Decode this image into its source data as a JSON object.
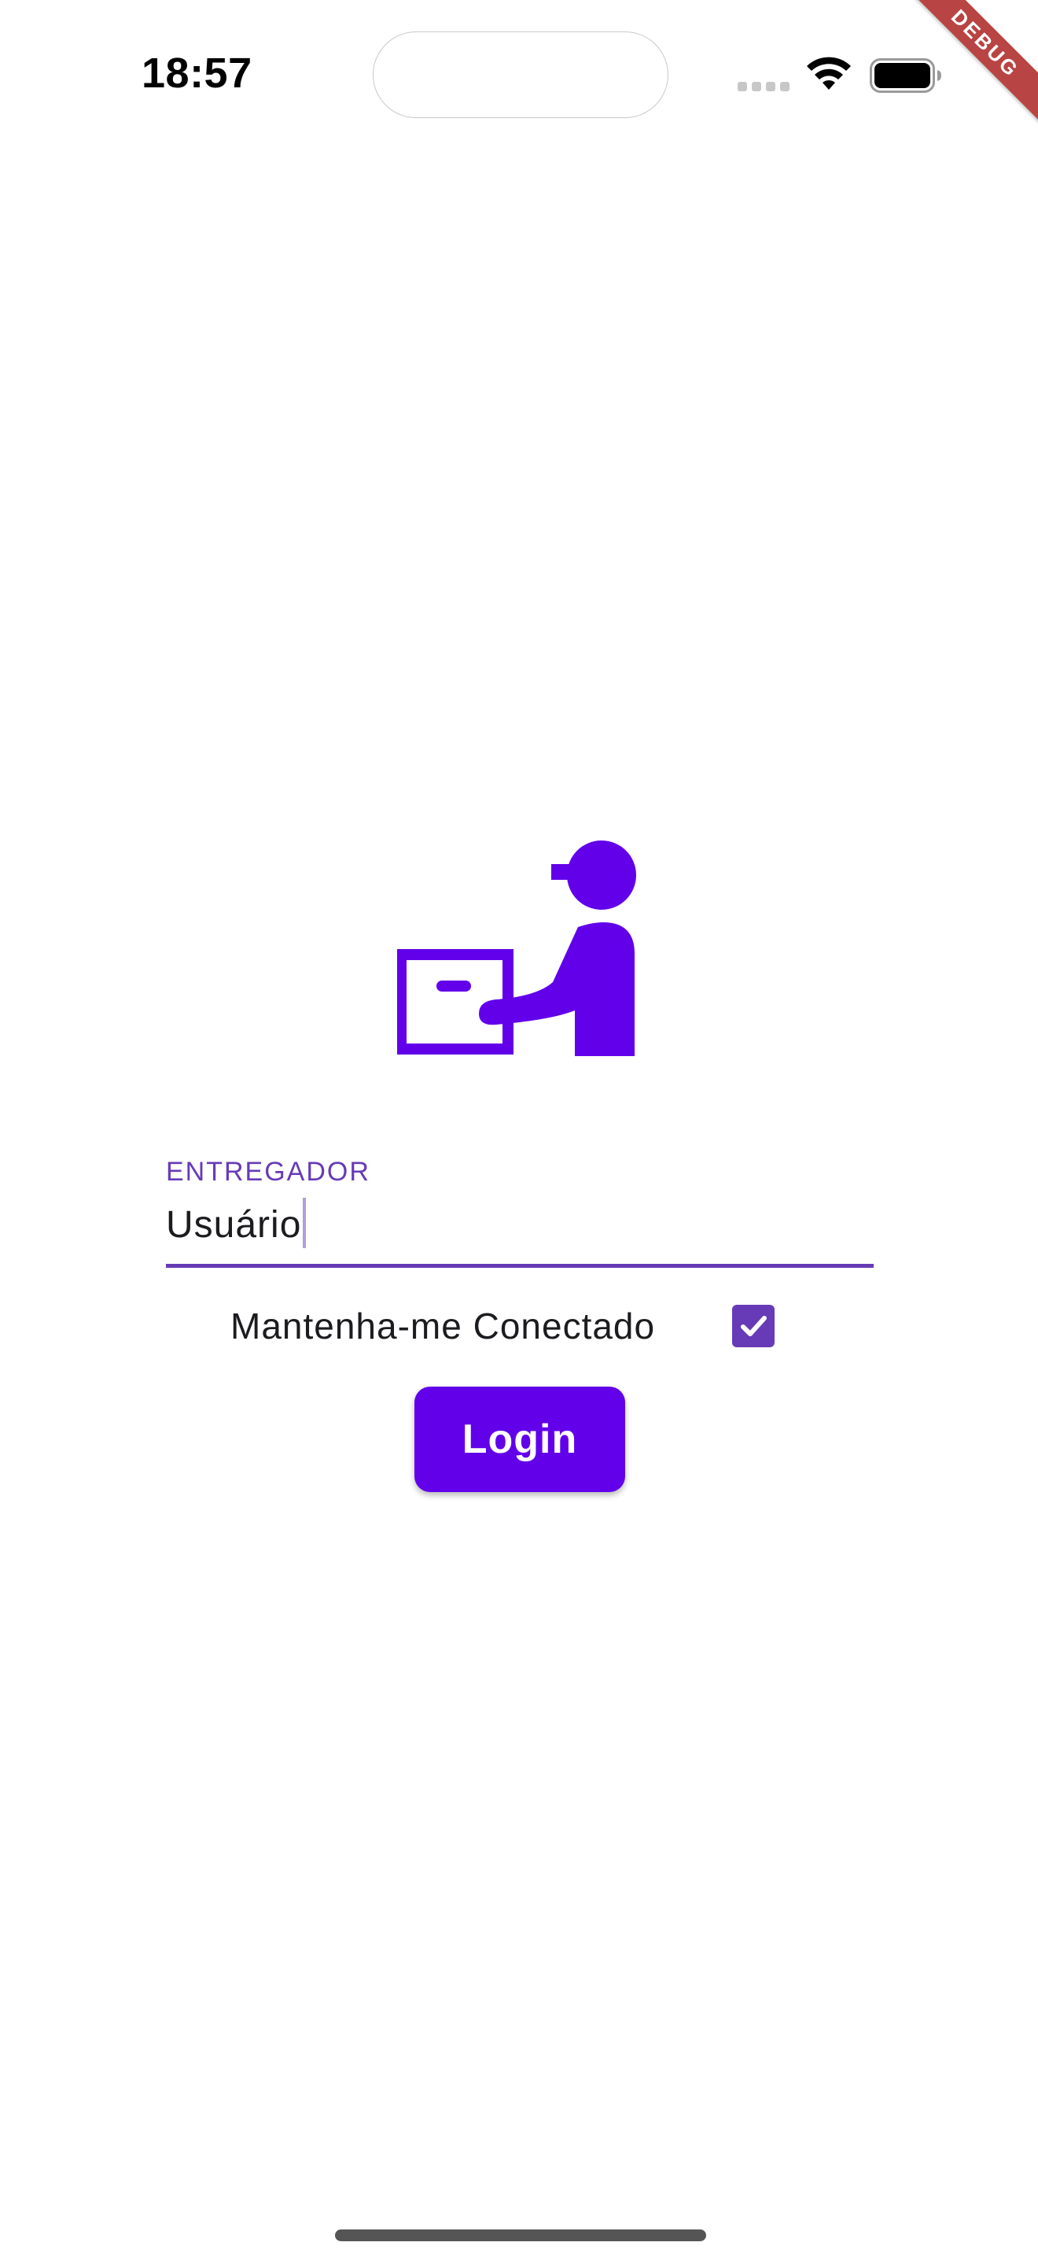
{
  "status_bar": {
    "time": "18:57",
    "icons": [
      "cell-signal-icon",
      "wifi-icon",
      "battery-icon"
    ]
  },
  "debug_banner": {
    "label": "DEBUG",
    "color": "#b84443"
  },
  "hero": {
    "icon": "delivery-person-icon",
    "color": "#6200ea"
  },
  "form": {
    "username": {
      "label": "ENTREGADOR",
      "value": "Usuário"
    },
    "remember_me": {
      "label": "Mantenha-me Conectado",
      "checked": true
    },
    "login_button": {
      "label": "Login"
    }
  },
  "theme": {
    "primary": "#673ab7",
    "button": "#6200ea",
    "background": "#ffffff"
  }
}
